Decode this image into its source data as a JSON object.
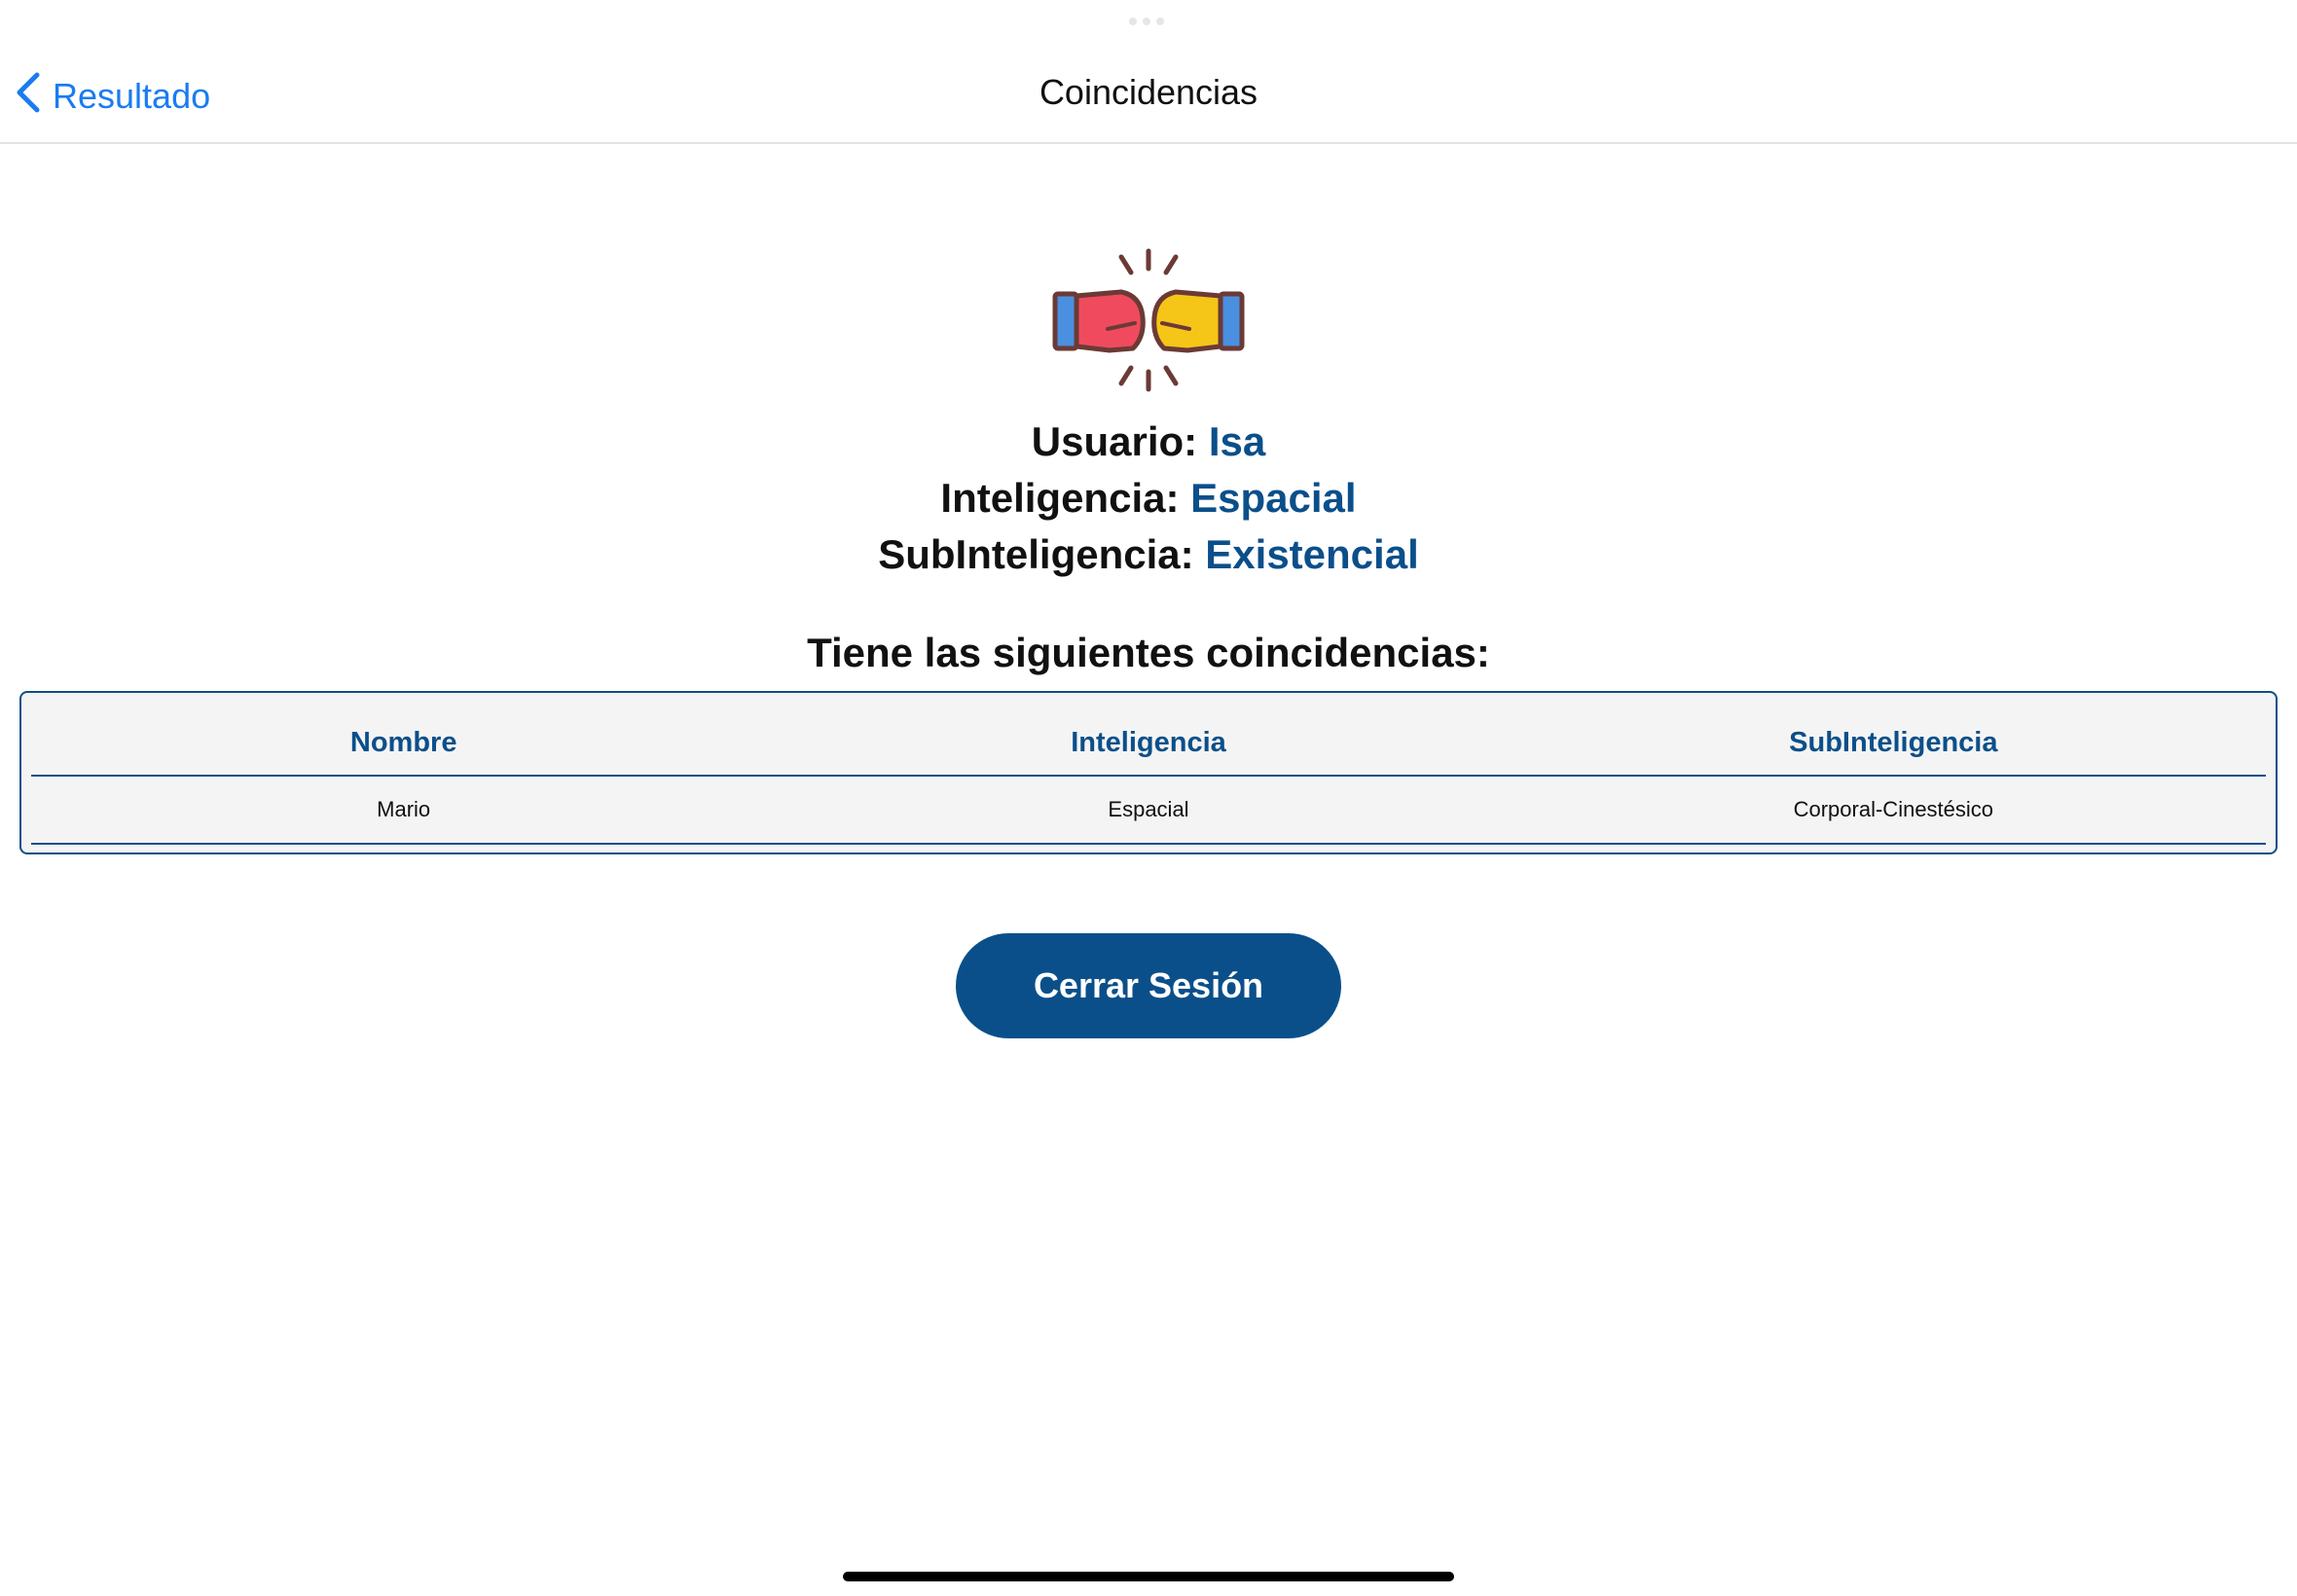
{
  "nav": {
    "back_label": "Resultado",
    "title": "Coincidencias"
  },
  "profile": {
    "user_label": "Usuario:",
    "user_value": "Isa",
    "intelligence_label": "Inteligencia:",
    "intelligence_value": "Espacial",
    "subintelligence_label": "SubInteligencia:",
    "subintelligence_value": "Existencial"
  },
  "matches": {
    "heading": "Tiene las siguientes coincidencias:",
    "columns": [
      "Nombre",
      "Inteligencia",
      "SubInteligencia"
    ],
    "rows": [
      [
        "Mario",
        "Espacial",
        "Corporal-Cinestésico"
      ]
    ]
  },
  "actions": {
    "logout_label": "Cerrar Sesión"
  },
  "icons": {
    "back": "chevron-left-icon",
    "hero": "fist-bump-icon"
  },
  "colors": {
    "accent": "#0b4f8a",
    "link": "#1a7cf0",
    "table_bg": "#f4f4f4"
  }
}
